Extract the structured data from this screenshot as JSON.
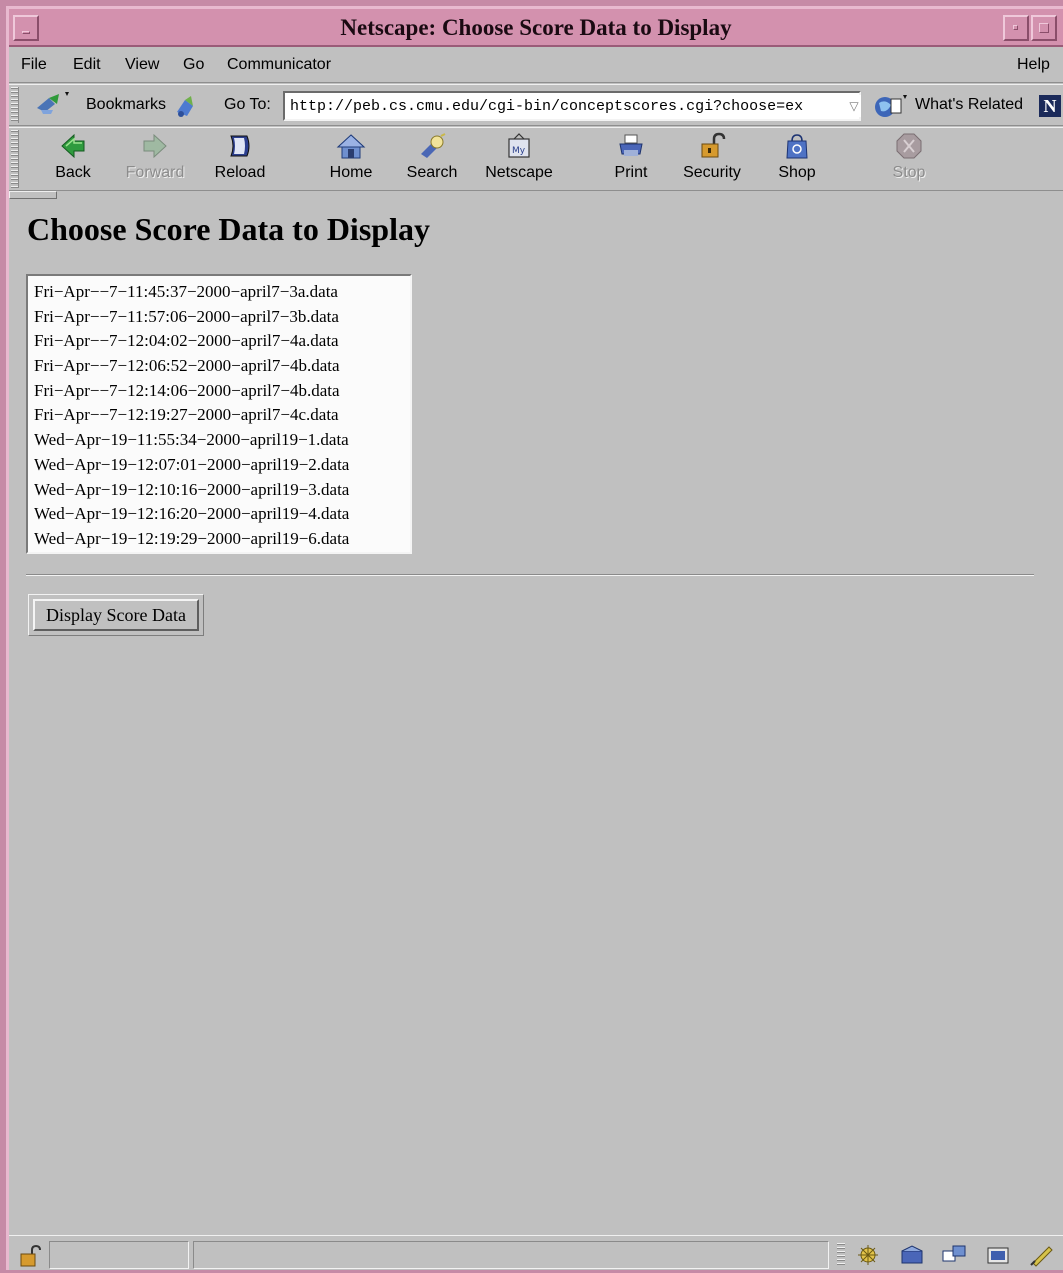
{
  "window": {
    "title": "Netscape: Choose Score Data to Display"
  },
  "menubar": {
    "items": [
      "File",
      "Edit",
      "View",
      "Go",
      "Communicator"
    ],
    "help": "Help"
  },
  "location": {
    "bookmarks_label": "Bookmarks",
    "goto_label": "Go To:",
    "url": "http://peb.cs.cmu.edu/cgi-bin/conceptscores.cgi?choose=ex",
    "whats_related_label": "What's Related"
  },
  "toolbar": {
    "back": "Back",
    "forward": "Forward",
    "reload": "Reload",
    "home": "Home",
    "search": "Search",
    "netscape": "Netscape",
    "print": "Print",
    "security": "Security",
    "shop": "Shop",
    "stop": "Stop"
  },
  "page": {
    "heading": "Choose Score Data to Display",
    "files": [
      "Fri−Apr−−7−11:45:37−2000−april7−3a.data",
      "Fri−Apr−−7−11:57:06−2000−april7−3b.data",
      "Fri−Apr−−7−12:04:02−2000−april7−4a.data",
      "Fri−Apr−−7−12:06:52−2000−april7−4b.data",
      "Fri−Apr−−7−12:14:06−2000−april7−4b.data",
      "Fri−Apr−−7−12:19:27−2000−april7−4c.data",
      "Wed−Apr−19−11:55:34−2000−april19−1.data",
      "Wed−Apr−19−12:07:01−2000−april19−2.data",
      "Wed−Apr−19−12:10:16−2000−april19−3.data",
      "Wed−Apr−19−12:16:20−2000−april19−4.data",
      "Wed−Apr−19−12:19:29−2000−april19−6.data"
    ],
    "submit_label": "Display Score Data"
  },
  "icons": {
    "bookmarks": "bookmarks-icon",
    "whats_related": "whats-related-icon",
    "netscape_logo": "netscape-n-logo",
    "status_lock": "unlocked-padlock-icon"
  },
  "colors": {
    "window_frame": "#d391ae",
    "chrome_gray": "#c0c0c0",
    "listbox_bg": "#fbfbfb"
  }
}
